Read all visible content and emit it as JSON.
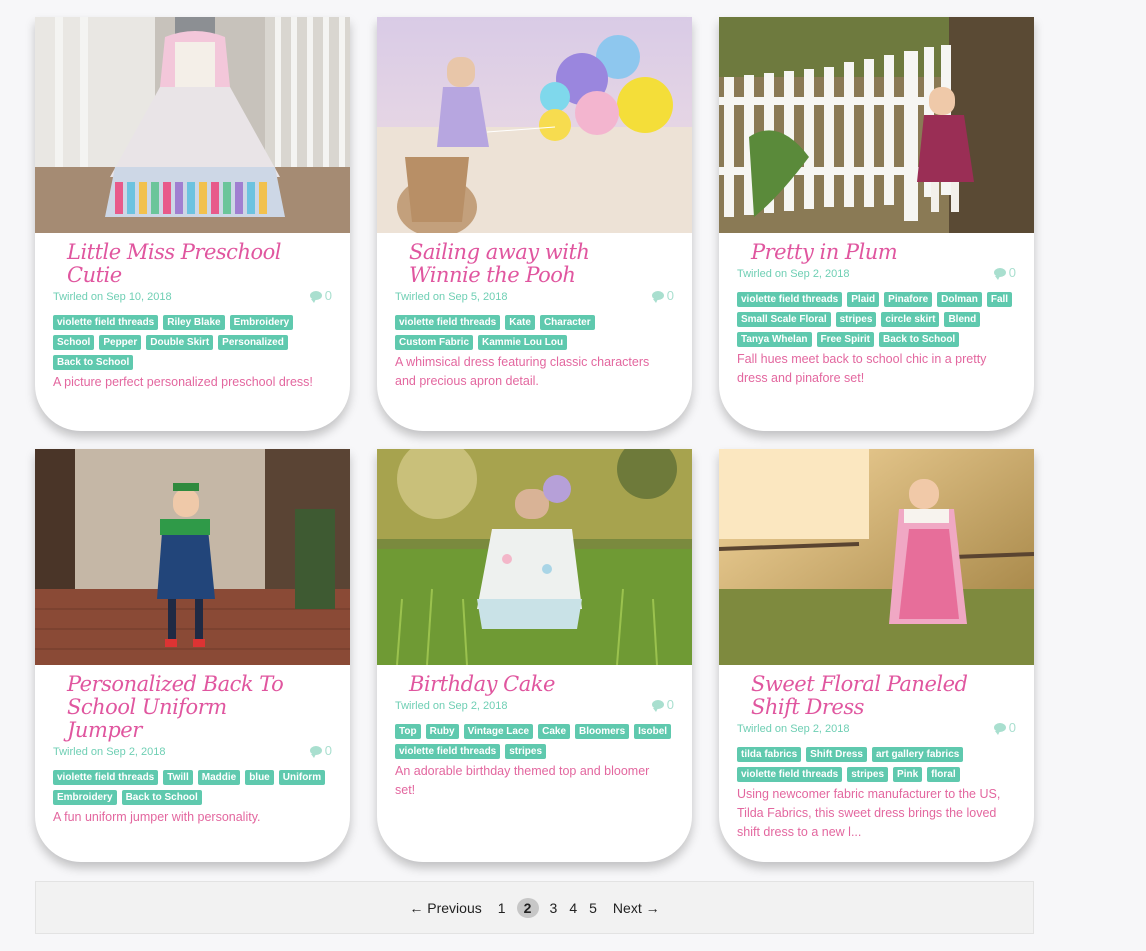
{
  "posts": [
    {
      "title": "Little Miss Preschool Cutie",
      "date": "Twirled on Sep 10, 2018",
      "comments": "0",
      "tags": [
        "violette field threads",
        "Riley Blake",
        "Embroidery",
        "School",
        "Pepper",
        "Double Skirt",
        "Personalized",
        "Back to School"
      ],
      "excerpt": "A picture perfect personalized preschool dress!"
    },
    {
      "title": "Sailing away with Winnie the Pooh",
      "date": "Twirled on Sep 5, 2018",
      "comments": "0",
      "tags": [
        "violette field threads",
        "Kate",
        "Character",
        "Custom Fabric",
        "Kammie Lou Lou"
      ],
      "excerpt": "A whimsical dress featuring classic characters and precious apron detail."
    },
    {
      "title": "Pretty in Plum",
      "date": "Twirled on Sep 2, 2018",
      "comments": "0",
      "tags": [
        "violette field threads",
        "Plaid",
        "Pinafore",
        "Dolman",
        "Fall",
        "Small Scale Floral",
        "stripes",
        "circle skirt",
        "Blend",
        "Tanya Whelan",
        "Free Spirit",
        "Back to School"
      ],
      "excerpt": "Fall hues meet back to school chic in a pretty dress and pinafore set!"
    },
    {
      "title": "Personalized Back To School Uniform Jumper",
      "date": "Twirled on Sep 2, 2018",
      "comments": "0",
      "tags": [
        "violette field threads",
        "Twill",
        "Maddie",
        "blue",
        "Uniform",
        "Embroidery",
        "Back to School"
      ],
      "excerpt": "A fun uniform jumper with personality."
    },
    {
      "title": "Birthday Cake",
      "date": "Twirled on Sep 2, 2018",
      "comments": "0",
      "tags": [
        "Top",
        "Ruby",
        "Vintage Lace",
        "Cake",
        "Bloomers",
        "Isobel",
        "violette field threads",
        "stripes"
      ],
      "excerpt": "An adorable birthday themed top and bloomer set!"
    },
    {
      "title": "Sweet Floral Paneled Shift Dress",
      "date": "Twirled on Sep 2, 2018",
      "comments": "0",
      "tags": [
        "tilda fabrics",
        "Shift Dress",
        "art gallery fabrics",
        "violette field threads",
        "stripes",
        "Pink",
        "floral"
      ],
      "excerpt": "Using newcomer fabric manufacturer to the US, Tilda Fabrics, this sweet dress brings the loved shift dress to a new l..."
    }
  ],
  "pagination": {
    "previous": "← Previous",
    "pages": [
      "1",
      "2",
      "3",
      "4",
      "5"
    ],
    "current": "2",
    "next": "Next →"
  },
  "colors": {
    "title_pink": "#e0569f",
    "tag_green": "#5fc9ae",
    "date_green": "#6fcfb4"
  }
}
